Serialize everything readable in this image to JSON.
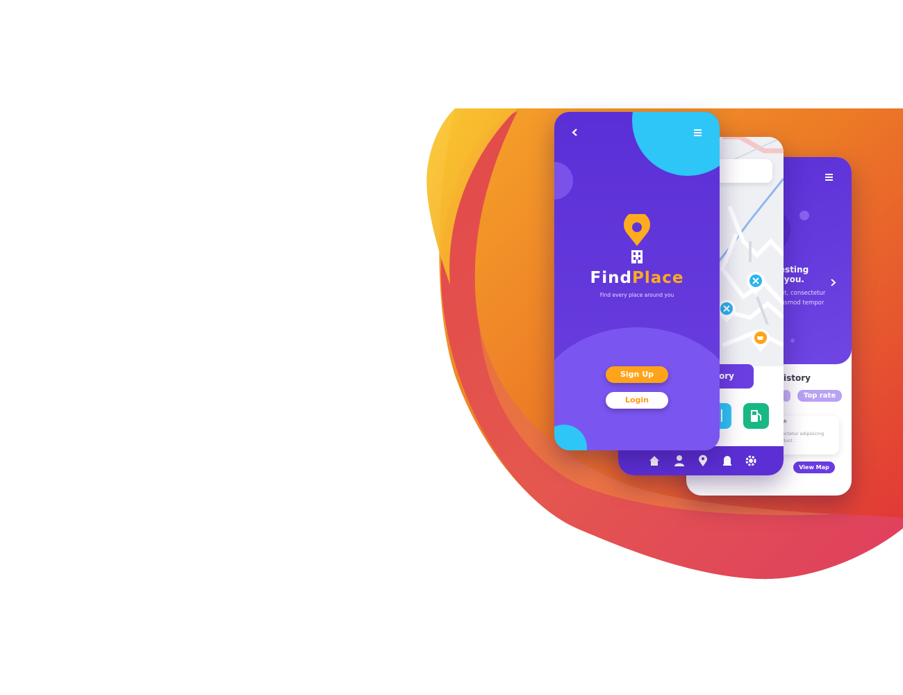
{
  "colors": {
    "purple": "#5a2fd6",
    "orange": "#ffa31a",
    "cyan": "#2ec5f7",
    "green": "#17b884",
    "blob_yellow": "#f9c02f",
    "blob_orange": "#ef8a20",
    "blob_red": "#e23a38",
    "blob_pink": "#de4a6a"
  },
  "front_phone": {
    "brand_part1": "Find",
    "brand_part2": "Place",
    "tagline": "Find every place around you",
    "signup_label": "Sign Up",
    "login_label": "Login",
    "icons": [
      "chevron-left-icon",
      "menu-icon",
      "location-pin-icon",
      "building-icon"
    ]
  },
  "map_phone": {
    "category_button": "ory",
    "nav_icons": [
      "home-icon",
      "user-icon",
      "location-pin-icon",
      "bell-icon",
      "gear-icon"
    ],
    "map_markers": [
      "restaurant-icon",
      "restaurant-icon",
      "coffee-icon"
    ],
    "tiles": [
      "restaurant-icon",
      "fuel-icon"
    ]
  },
  "history_phone": {
    "headline_line1": "resting",
    "headline_line2": "d you.",
    "body_line1": "et, consectetur",
    "body_line2": "usmod tempor",
    "section_title": "istory",
    "tab_top_rate": "Top rate",
    "card_line1": "ectetur adipisicing",
    "card_line2": "dunt .",
    "view_map": "View Map"
  }
}
